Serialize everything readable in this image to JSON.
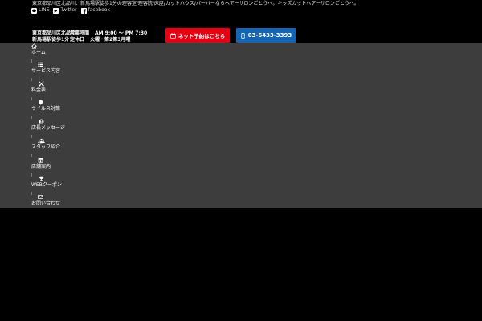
{
  "header": {
    "tagline": "東京都品川区北品川、新馬場駅徒歩1分の理容室/理容院/床屋/カットハウス/バーバーならヘアーサロンごとうへ。キッズカットヘアーサロンごとうへ。",
    "social": [
      {
        "label": "LINE",
        "icon": "line-icon"
      },
      {
        "label": "Twitter",
        "icon": "twitter-icon"
      },
      {
        "label": "facebook",
        "icon": "facebook-icon"
      }
    ],
    "address": "東京都品川区北品川",
    "access": "新馬場駅徒歩1分",
    "hours_label": "営業時間",
    "hours": "AM 9:00 ～ PM 7:30",
    "closed_label": "定休日",
    "closed": "火曜・第2第3月曜",
    "reserve_button": "ネット予約はこちら",
    "phone_button": "03-6433-3393",
    "colors": {
      "reserve": "#e60012",
      "phone": "#1565b5",
      "nav_bg": "#3d3d3d"
    }
  },
  "nav": {
    "items": [
      {
        "label": "ホーム",
        "icon": "home-icon"
      },
      {
        "label": "サービス内容",
        "icon": "list-icon"
      },
      {
        "label": "料金表",
        "icon": "scissors-icon"
      },
      {
        "label": "ウイルス対策",
        "icon": "virus-shield-icon"
      },
      {
        "label": "店長メッセージ",
        "icon": "user-icon"
      },
      {
        "label": "スタッフ紹介",
        "icon": "users-icon"
      },
      {
        "label": "店舗案内",
        "icon": "shop-icon"
      },
      {
        "label": "WEBクーポン",
        "icon": "trophy-icon"
      },
      {
        "label": "お問い合わせ",
        "icon": "mail-icon"
      }
    ]
  }
}
